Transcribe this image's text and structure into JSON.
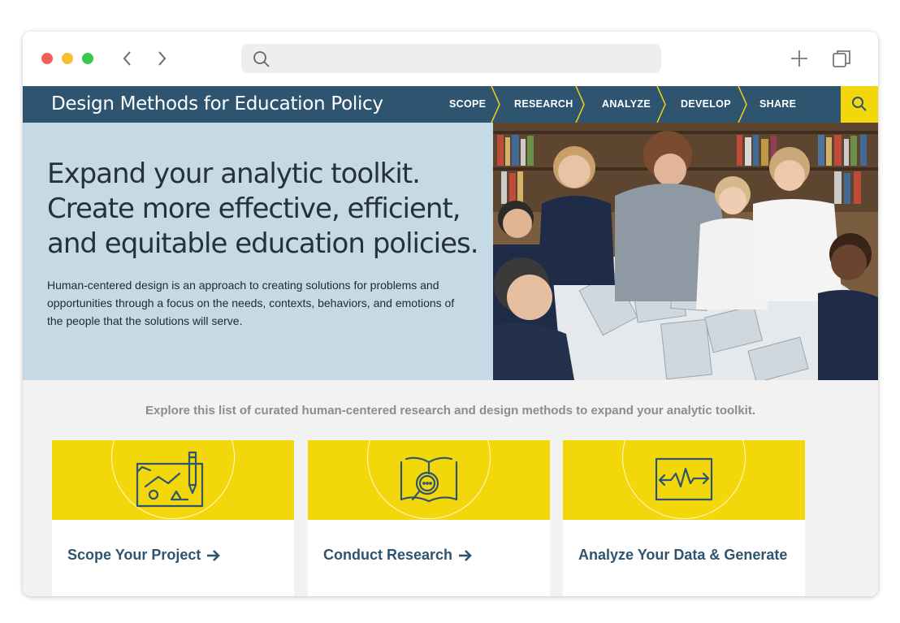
{
  "browser": {
    "url": "",
    "icons": [
      "back-icon",
      "forward-icon",
      "search-icon",
      "new-tab-icon",
      "tabs-icon"
    ]
  },
  "site": {
    "brand": "Design Methods for Education Policy",
    "nav": [
      {
        "label": "SCOPE"
      },
      {
        "label": "RESEARCH"
      },
      {
        "label": "ANALYZE"
      },
      {
        "label": "DEVELOP"
      },
      {
        "label": "SHARE"
      }
    ],
    "colors": {
      "navy": "#2e5470",
      "yellow": "#f2d70a",
      "hero_bg": "#c5dae4"
    }
  },
  "hero": {
    "headline_lines": [
      "Expand your analytic toolkit.",
      "Create more effective, efficient,",
      "and equitable education policies."
    ],
    "description": "Human-centered design is an approach to creating solutions for problems and opportunities through a focus on the needs, contexts, behaviors, and emotions of the people that the solutions will serve."
  },
  "explore": {
    "text": "Explore this list of curated human-centered research and design methods to expand your analytic toolkit."
  },
  "cards": [
    {
      "title": "Scope Your Project",
      "icon": "chart-pencil-icon",
      "arrow": true
    },
    {
      "title": "Conduct Research",
      "icon": "book-magnifier-icon",
      "arrow": true
    },
    {
      "title": "Analyze Your Data & Generate",
      "icon": "pulse-monitor-icon",
      "arrow": false
    }
  ]
}
